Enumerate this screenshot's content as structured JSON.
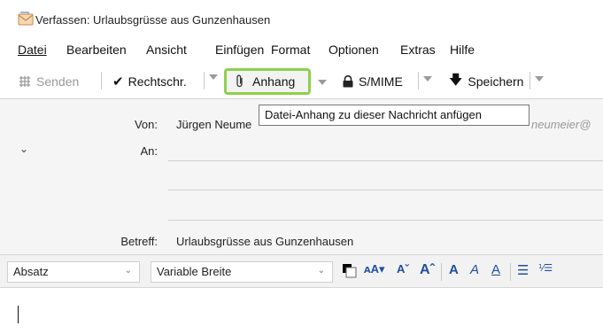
{
  "window": {
    "title": "Verfassen: Urlaubsgrüsse aus Gunzenhausen"
  },
  "menu": {
    "items": [
      {
        "label": "Datei"
      },
      {
        "label": "Bearbeiten"
      },
      {
        "label": "Ansicht"
      },
      {
        "label": "Einfügen"
      },
      {
        "label": "Format"
      },
      {
        "label": "Optionen"
      },
      {
        "label": "Extras"
      },
      {
        "label": "Hilfe"
      }
    ]
  },
  "toolbar": {
    "send_label": "Senden",
    "spell_label": "Rechtschr.",
    "attach_label": "Anhang",
    "smime_label": "S/MIME",
    "save_label": "Speichern"
  },
  "tooltip": {
    "text": "Datei-Anhang zu dieser Nachricht anfügen"
  },
  "header": {
    "from_label": "Von:",
    "from_value": "Jürgen Neume",
    "from_value_tail": "neumeier@",
    "to_label": "An:",
    "to_value": "",
    "subject_label": "Betreff:",
    "subject_value": "Urlaubsgrüsse aus Gunzenhausen"
  },
  "format": {
    "paragraph_style": "Absatz",
    "font": "Variable Breite",
    "color_accent": "#1f4e9c",
    "highlight_color": "#8ed14b"
  },
  "editor": {
    "body": ""
  }
}
